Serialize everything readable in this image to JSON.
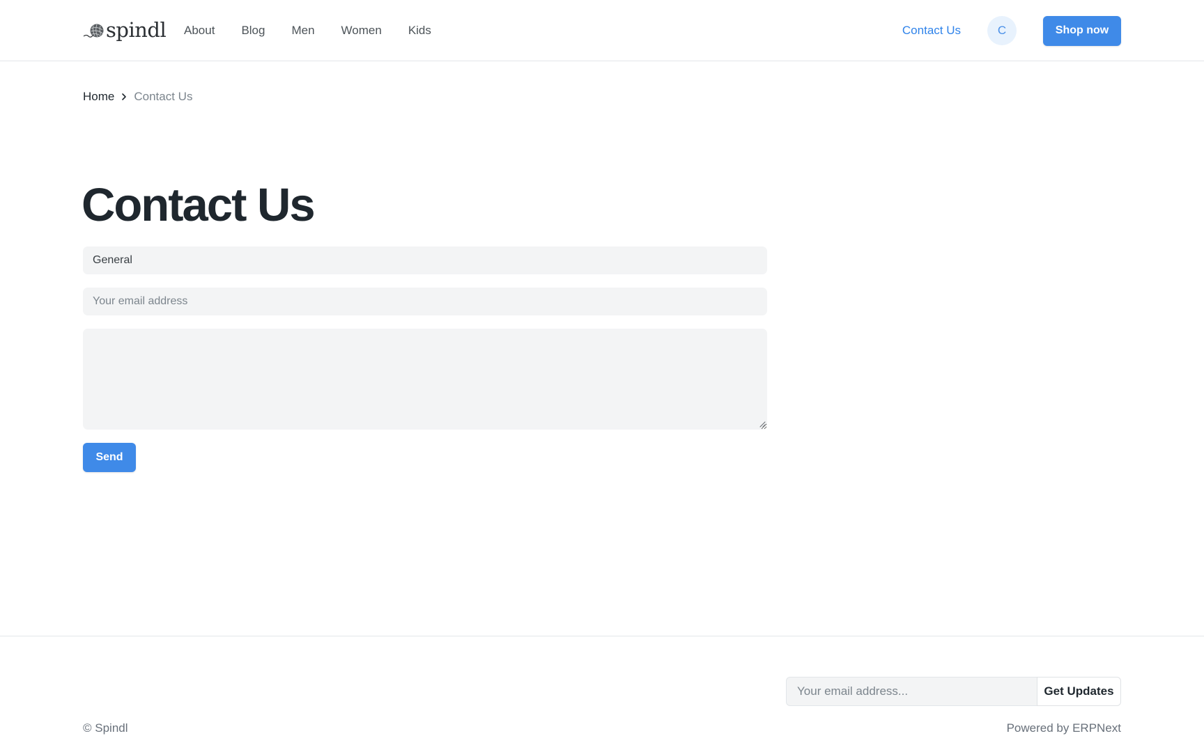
{
  "header": {
    "brand": "spindl",
    "nav": [
      "About",
      "Blog",
      "Men",
      "Women",
      "Kids"
    ],
    "contact_label": "Contact Us",
    "avatar_initial": "C",
    "shop_label": "Shop now"
  },
  "breadcrumb": {
    "home": "Home",
    "current": "Contact Us"
  },
  "main": {
    "title": "Contact Us",
    "subject_value": "General",
    "email_placeholder": "Your email address",
    "message_value": "",
    "send_label": "Send"
  },
  "footer": {
    "subscribe_placeholder": "Your email address...",
    "subscribe_button": "Get Updates",
    "copyright": "© Spindl",
    "powered": "Powered by ERPNext"
  },
  "colors": {
    "accent": "#3f8ae8",
    "link": "#2f83ea",
    "text": "#1f272e",
    "muted": "#7c858d",
    "field_bg": "#f3f4f5"
  }
}
